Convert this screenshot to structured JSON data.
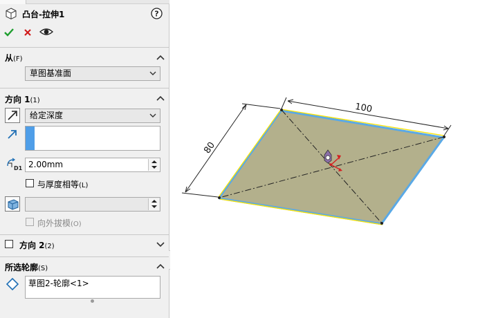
{
  "feature": {
    "title": "凸台-拉伸1",
    "help_icon": "question-circle-icon",
    "ok_icon": "check-icon",
    "cancel_icon": "close-icon",
    "preview_icon": "eye-icon"
  },
  "from": {
    "title": "从",
    "shortcut": "(F)",
    "value": "草图基准面"
  },
  "direction1": {
    "title": "方向 1",
    "shortcut": "(1)",
    "end_condition": "给定深度",
    "depth": "2.00mm",
    "equal_thickness_label": "与厚度相等",
    "equal_thickness_shortcut": "(L)",
    "equal_thickness_checked": false,
    "draft_value": "",
    "draft_outward_label": "向外拔模",
    "draft_outward_shortcut": "(O)",
    "draft_outward_checked": false
  },
  "direction2": {
    "title": "方向 2",
    "shortcut": "(2)",
    "checked": false
  },
  "contours": {
    "title": "所选轮廓",
    "shortcut": "(S)",
    "items": [
      "草图2-轮廓<1>"
    ]
  },
  "model": {
    "dim_length": "100",
    "dim_width": "80",
    "face_color": "#b3b08c",
    "edge_highlight": "#ffe400",
    "edge_selected": "#5aa9e6"
  }
}
